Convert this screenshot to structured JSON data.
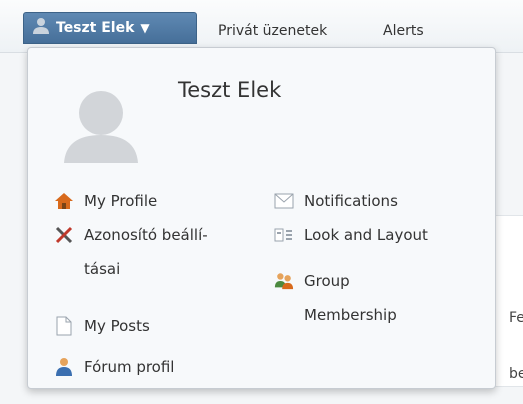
{
  "navbar": {
    "user_button_label": "Teszt Elek",
    "private_messages": "Privát üzenetek",
    "alerts": "Alerts"
  },
  "panel": {
    "username": "Teszt Elek",
    "left_menu": [
      {
        "label": "My Profile",
        "icon": "house-icon"
      },
      {
        "label_line1": "Azonosító beállí-",
        "label_line2": "tásai",
        "icon": "tools-icon"
      },
      {
        "label": "My Posts",
        "icon": "document-icon"
      },
      {
        "label": "Fórum profil",
        "icon": "person-icon"
      }
    ],
    "right_menu": [
      {
        "label": "Notifications",
        "icon": "envelope-icon"
      },
      {
        "label": "Look and Layout",
        "icon": "layout-icon"
      },
      {
        "label_line1": "Group",
        "label_line2": "Membership",
        "icon": "group-icon"
      }
    ]
  },
  "background": {
    "fragment_1": "Fe",
    "fragment_2": "be"
  }
}
